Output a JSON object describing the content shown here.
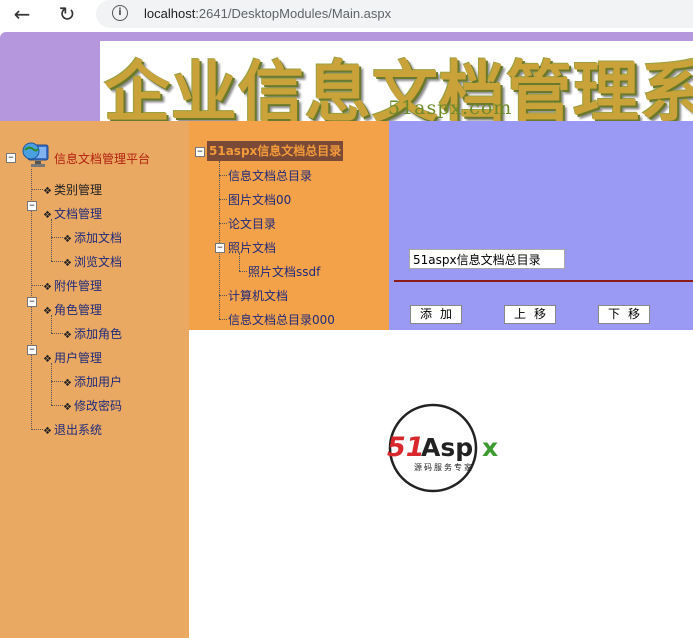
{
  "browser": {
    "url_host": "localhost",
    "url_rest": ":2641/DesktopModules/Main.aspx"
  },
  "banner": {
    "title": "企业信息文档管理系",
    "subtitle": "51aspx.com"
  },
  "left_tree": {
    "root": "信息文档管理平台",
    "items": [
      "类别管理",
      "文档管理",
      "添加文档",
      "浏览文档",
      "附件管理",
      "角色管理",
      "添加角色",
      "用户管理",
      "添加用户",
      "修改密码",
      "退出系统"
    ]
  },
  "mid_tree": {
    "root": "51aspx信息文档总目录",
    "items": [
      "信息文档总目录",
      "图片文档00",
      "论文目录",
      "照片文档",
      "照片文档ssdf",
      "计算机文档",
      "信息文档总目录000"
    ]
  },
  "form": {
    "category_value": "51aspx信息文档总目录",
    "add_button": "添加",
    "up_button": "上移",
    "down_button": "下移"
  },
  "logo": {
    "brand": "51Aspx",
    "tagline": "源码服务专家"
  },
  "colors": {
    "left_panel": "#eaa962",
    "mid_panel": "#f4a24a",
    "right_panel": "#9a99f4",
    "banner_band": "#b497dc",
    "selected_node_bg": "#7a4a36"
  }
}
